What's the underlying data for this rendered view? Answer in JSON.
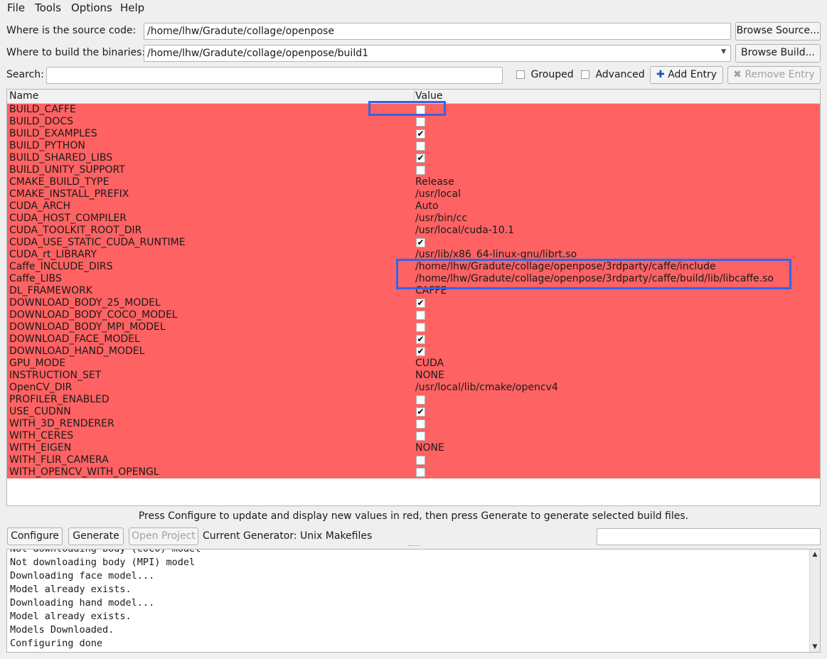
{
  "menu": {
    "file": "File",
    "tools": "Tools",
    "options": "Options",
    "help": "Help"
  },
  "source": {
    "label": "Where is the source code:",
    "value": "/home/lhw/Gradute/collage/openpose",
    "browse_label": "Browse Source..."
  },
  "build": {
    "label": "Where to build the binaries:",
    "value": "/home/lhw/Gradute/collage/openpose/build1",
    "browse_label": "Browse Build..."
  },
  "search": {
    "label": "Search:",
    "value": ""
  },
  "options": {
    "grouped": "Grouped",
    "advanced": "Advanced",
    "add_entry": "Add Entry",
    "remove_entry": "Remove Entry"
  },
  "table": {
    "col_name": "Name",
    "col_value": "Value",
    "rows": [
      {
        "name": "BUILD_CAFFE",
        "type": "bool",
        "checked": false
      },
      {
        "name": "BUILD_DOCS",
        "type": "bool",
        "checked": false
      },
      {
        "name": "BUILD_EXAMPLES",
        "type": "bool",
        "checked": true
      },
      {
        "name": "BUILD_PYTHON",
        "type": "bool",
        "checked": false
      },
      {
        "name": "BUILD_SHARED_LIBS",
        "type": "bool",
        "checked": true
      },
      {
        "name": "BUILD_UNITY_SUPPORT",
        "type": "bool",
        "checked": false
      },
      {
        "name": "CMAKE_BUILD_TYPE",
        "type": "text",
        "value": "Release"
      },
      {
        "name": "CMAKE_INSTALL_PREFIX",
        "type": "text",
        "value": "/usr/local"
      },
      {
        "name": "CUDA_ARCH",
        "type": "text",
        "value": "Auto"
      },
      {
        "name": "CUDA_HOST_COMPILER",
        "type": "text",
        "value": "/usr/bin/cc"
      },
      {
        "name": "CUDA_TOOLKIT_ROOT_DIR",
        "type": "text",
        "value": "/usr/local/cuda-10.1"
      },
      {
        "name": "CUDA_USE_STATIC_CUDA_RUNTIME",
        "type": "bool",
        "checked": true
      },
      {
        "name": "CUDA_rt_LIBRARY",
        "type": "text",
        "value": "/usr/lib/x86_64-linux-gnu/librt.so"
      },
      {
        "name": "Caffe_INCLUDE_DIRS",
        "type": "text",
        "value": "/home/lhw/Gradute/collage/openpose/3rdparty/caffe/include"
      },
      {
        "name": "Caffe_LIBS",
        "type": "text",
        "value": "/home/lhw/Gradute/collage/openpose/3rdparty/caffe/build/lib/libcaffe.so"
      },
      {
        "name": "DL_FRAMEWORK",
        "type": "text",
        "value": "CAFFE"
      },
      {
        "name": "DOWNLOAD_BODY_25_MODEL",
        "type": "bool",
        "checked": true
      },
      {
        "name": "DOWNLOAD_BODY_COCO_MODEL",
        "type": "bool",
        "checked": false
      },
      {
        "name": "DOWNLOAD_BODY_MPI_MODEL",
        "type": "bool",
        "checked": false
      },
      {
        "name": "DOWNLOAD_FACE_MODEL",
        "type": "bool",
        "checked": true
      },
      {
        "name": "DOWNLOAD_HAND_MODEL",
        "type": "bool",
        "checked": true
      },
      {
        "name": "GPU_MODE",
        "type": "text",
        "value": "CUDA"
      },
      {
        "name": "INSTRUCTION_SET",
        "type": "text",
        "value": "NONE"
      },
      {
        "name": "OpenCV_DIR",
        "type": "text",
        "value": "/usr/local/lib/cmake/opencv4"
      },
      {
        "name": "PROFILER_ENABLED",
        "type": "bool",
        "checked": false
      },
      {
        "name": "USE_CUDNN",
        "type": "bool",
        "checked": true
      },
      {
        "name": "WITH_3D_RENDERER",
        "type": "bool",
        "checked": false
      },
      {
        "name": "WITH_CERES",
        "type": "bool",
        "checked": false
      },
      {
        "name": "WITH_EIGEN",
        "type": "text",
        "value": "NONE"
      },
      {
        "name": "WITH_FLIR_CAMERA",
        "type": "bool",
        "checked": false
      },
      {
        "name": "WITH_OPENCV_WITH_OPENGL",
        "type": "bool",
        "checked": false
      }
    ]
  },
  "hint": "Press Configure to update and display new values in red, then press Generate to generate selected build files.",
  "actions": {
    "configure": "Configure",
    "generate": "Generate",
    "open_project": "Open Project",
    "current_generator": "Current Generator: Unix Makefiles"
  },
  "log": [
    "Not downloading body (COCO) model",
    "Not downloading body (MPI) model",
    "Downloading face model...",
    "Model already exists.",
    "Downloading hand model...",
    "Model already exists.",
    "Models Downloaded.",
    "Configuring done"
  ],
  "colors": {
    "changed_row": "#ff6262",
    "highlight": "#3264e8"
  }
}
